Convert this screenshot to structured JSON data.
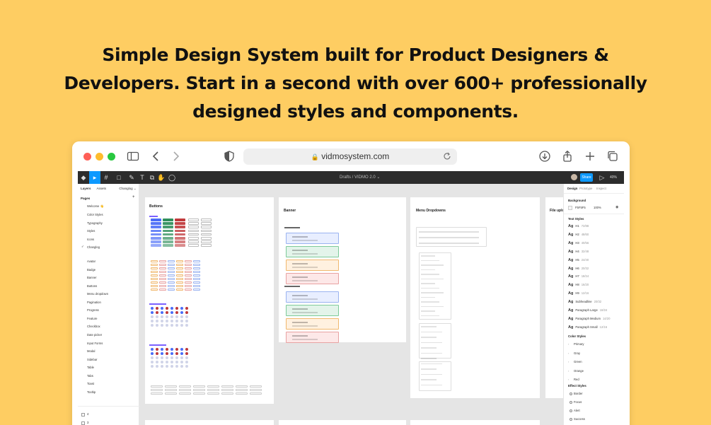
{
  "headline": {
    "line1": "Simple Design System built for Product Designers &",
    "line2": "Developers. Start in a second with over 600+ professionally",
    "line3": "designed styles and components."
  },
  "browser": {
    "url": "vidmosystem.com",
    "traffic_colors": [
      "#FF5F57",
      "#FEBC2E",
      "#28C840"
    ]
  },
  "figma": {
    "breadcrumb": "Drafts  /  VIDMO 2.0  ⌄",
    "share_label": "Share",
    "zoom": "40%",
    "left_tabs": [
      "Layers",
      "Assets",
      "Changlog ⌄"
    ],
    "pages_title": "Pages",
    "pages": [
      "Welcome 👋",
      "Color Styles",
      "Typography",
      "Styles",
      "Icons",
      "Changlog"
    ],
    "components": [
      "Avatar",
      "Badge",
      "Banner",
      "Buttons",
      "Menu dropdown",
      "Pagination",
      "Progress",
      "Feature",
      "Checkbox",
      "Date picker",
      "Input Forms",
      "Modal",
      "Sidebar",
      "Table",
      "Tabs",
      "Toast",
      "Tooltip"
    ],
    "layers": [
      "4",
      "3",
      "1"
    ],
    "right_tabs": [
      "Design",
      "Prototype",
      "Inspect"
    ],
    "background": {
      "title": "Background",
      "hex": "F5F5F5",
      "opacity": "100%"
    },
    "text_styles_title": "Text Styles",
    "text_styles": [
      {
        "n": "H1",
        "s": "72/88"
      },
      {
        "n": "H2",
        "s": "48/60"
      },
      {
        "n": "H3",
        "s": "40/56"
      },
      {
        "n": "H4",
        "s": "32/48"
      },
      {
        "n": "H5",
        "s": "24/40"
      },
      {
        "n": "H6",
        "s": "20/32"
      },
      {
        "n": "H7",
        "s": "18/24"
      },
      {
        "n": "H8",
        "s": "16/20"
      },
      {
        "n": "H9",
        "s": "12/16"
      },
      {
        "n": "Subheadline",
        "s": "20/32"
      },
      {
        "n": "Paragraph Large",
        "s": "18/24"
      },
      {
        "n": "Paragraph Medium",
        "s": "14/20"
      },
      {
        "n": "Paragraph Small",
        "s": "12/16"
      }
    ],
    "color_styles_title": "Color Styles",
    "color_styles": [
      "Primary",
      "Gray",
      "Green",
      "Orange",
      "Red"
    ],
    "effect_styles_title": "Effect Styles",
    "effect_styles": [
      "Border",
      "Focus",
      "Alert",
      "Success"
    ],
    "frames": {
      "buttons": "Buttons",
      "banner": "Banner",
      "menu": "Menu Dropdowns",
      "file": "File uplo"
    }
  }
}
